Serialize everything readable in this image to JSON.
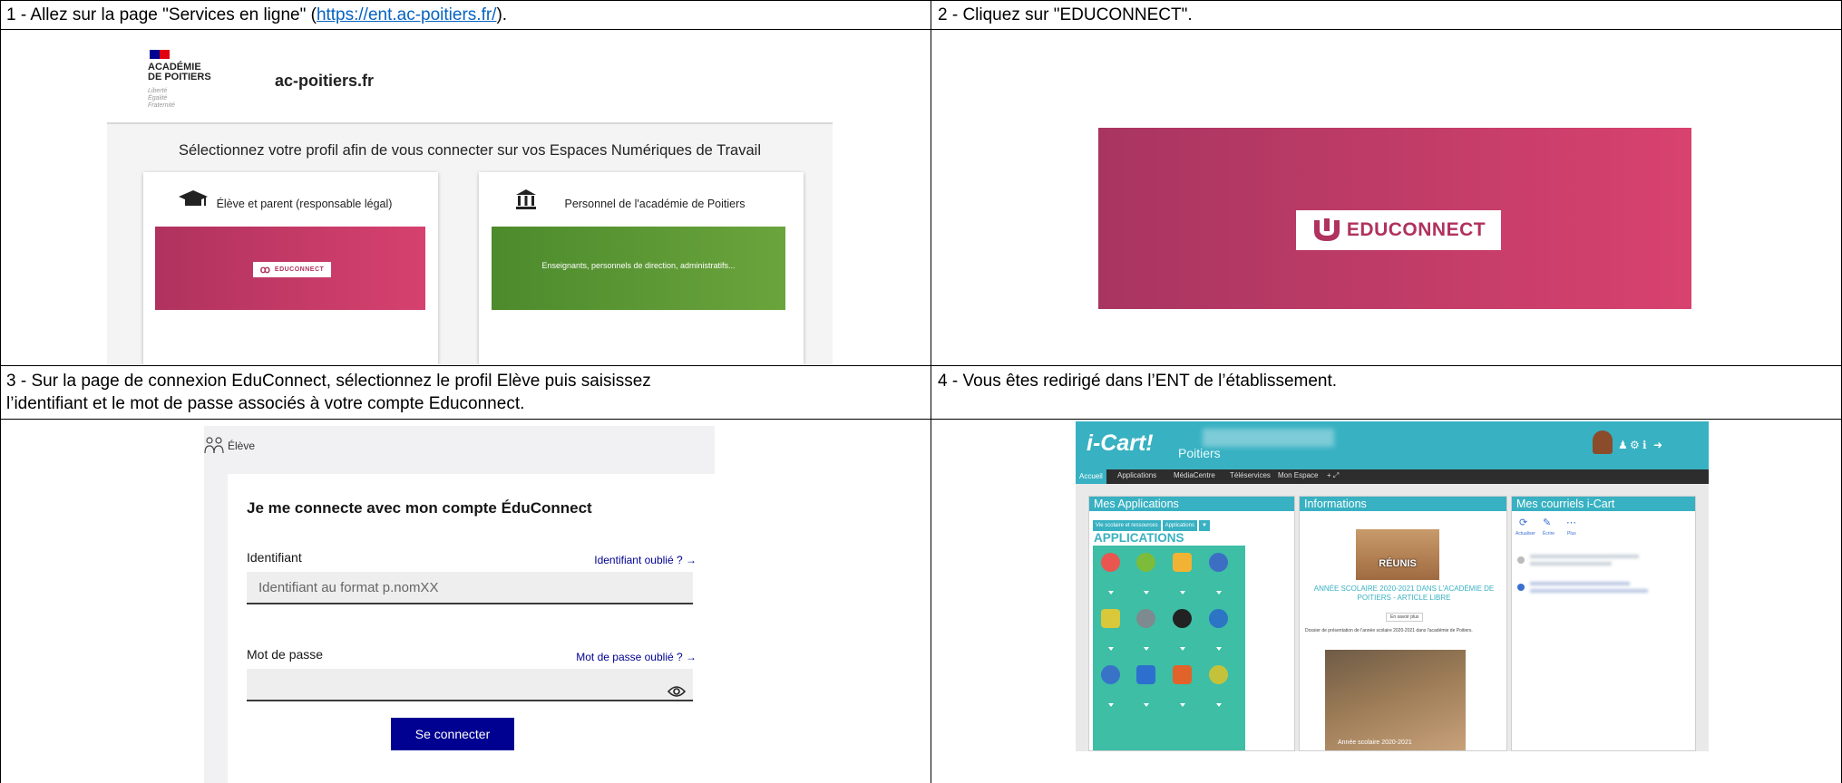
{
  "steps": [
    {
      "text_before": "1 - Allez sur la page \"Services en ligne\" (",
      "link": "https://ent.ac-poitiers.fr/",
      "text_after": ")."
    },
    {
      "text": "2 - Cliquez sur \"EDUCONNECT\"."
    },
    {
      "line1": "3 - Sur la page de connexion EduConnect, sélectionnez le profil Elève puis saisissez",
      "line2": "l’identifiant et le mot de passe associés à votre compte Educonnect."
    },
    {
      "text": "4 - Vous êtes redirigé dans l’ENT de l’établissement."
    }
  ],
  "panel1": {
    "academie_line1": "ACADÉMIE",
    "academie_line2": "DE POITIERS",
    "motto": [
      "Liberté",
      "Égalité",
      "Fraternité"
    ],
    "site_name": "ac-poitiers.fr",
    "headline": "Sélectionnez votre profil afin de vous connecter sur vos Espaces Numériques de Travail",
    "card_student": "Élève et parent (responsable légal)",
    "card_staff": "Personnel de l'académie de Poitiers",
    "educonnect": "EDUCONNECT",
    "staff_band": "Enseignants, personnels de direction, administratifs..."
  },
  "panel2": {
    "educonnect": "EDUCONNECT"
  },
  "panel3": {
    "role": "Élève",
    "title": "Je me connecte avec mon compte ÉduConnect",
    "id_label": "Identifiant",
    "id_forgot": "Identifiant oublié ? →",
    "id_placeholder": "Identifiant au format p.nomXX",
    "pw_label": "Mot de passe",
    "pw_forgot": "Mot de passe oublié ? →",
    "submit": "Se connecter"
  },
  "panel4": {
    "logo": "i-Cart!",
    "city": "Poitiers",
    "nav": [
      "Accueil",
      "Applications",
      "MédiaCentre",
      "Téléservices",
      "Mon Espace",
      "+ ⤢"
    ],
    "col_apps": "Mes Applications",
    "apps_pills": [
      "Vie scolaire et ressources",
      "Applications",
      "▼"
    ],
    "apps_title": "APPLICATIONS",
    "col_info": "Informations",
    "reunis": "RÉUNIS",
    "news_title": "ANNÉE SCOLAIRE 2020-2021 DANS L'ACADÉMIE DE POITIERS - ARTICLE LIBRE",
    "read_more": "En savoir plus",
    "news_body": "Dossier de présentation de l'année scolaire 2020-2021 dans l'académie de Poitiers.",
    "photo_caption": "Année scolaire 2020-2021",
    "col_mail": "Mes courriels i-Cart",
    "mail_tools": [
      "Actualiser",
      "Écrire",
      "Plus"
    ]
  },
  "colors": {
    "educonnect_pink": "#c53a67",
    "staff_green": "#5b9834",
    "dsfr_blue": "#000091",
    "icart_teal": "#38b1c2",
    "link_blue": "#0563c1"
  }
}
